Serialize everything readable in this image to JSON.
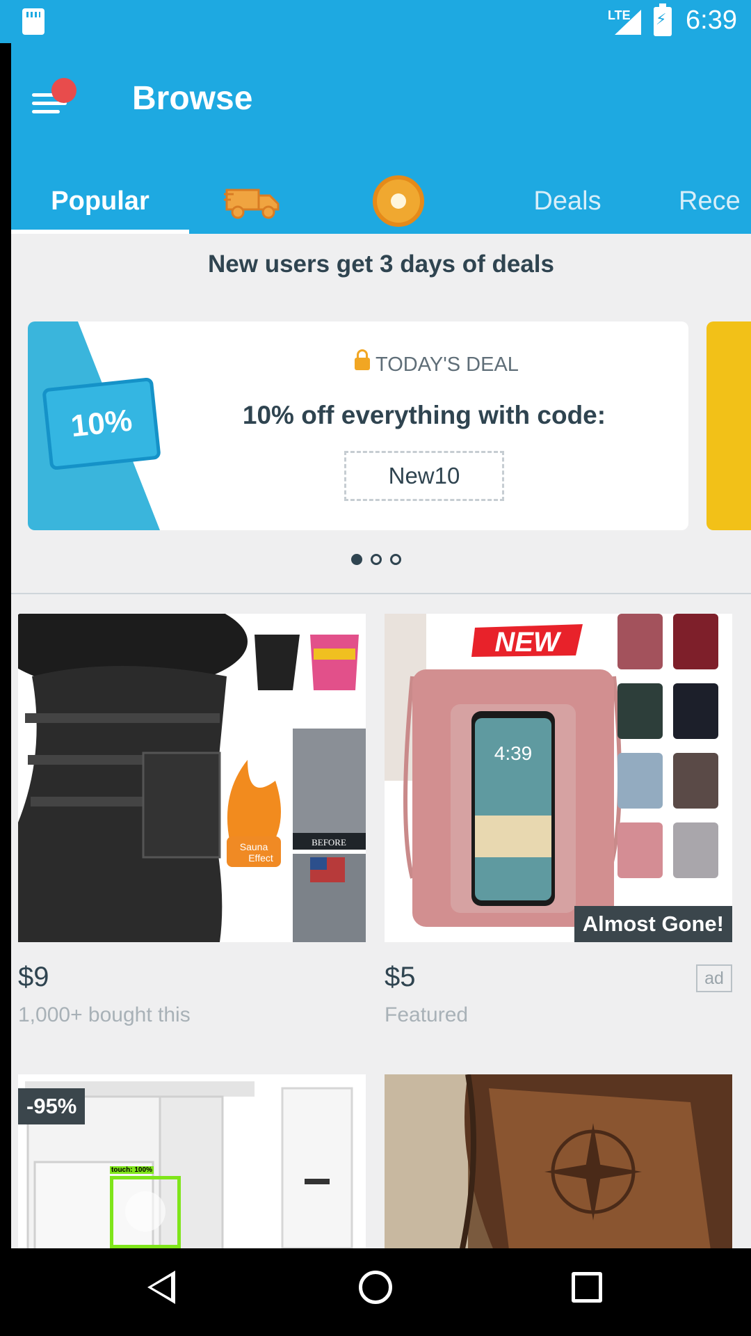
{
  "status_bar": {
    "network": "LTE",
    "time": "6:39"
  },
  "header": {
    "title": "Browse"
  },
  "tabs": [
    {
      "label": "Popular"
    },
    {
      "label": "",
      "icon": "delivery-truck-icon"
    },
    {
      "label": "",
      "icon": "coin-icon"
    },
    {
      "label": "Deals"
    },
    {
      "label": "Rece"
    }
  ],
  "promo": {
    "title": "New users get 3 days of deals",
    "card": {
      "ticket_text": "10%",
      "label": "TODAY'S DEAL",
      "headline": "10% off everything with code:",
      "code": "New10"
    },
    "pager_count": 3,
    "pager_active": 0
  },
  "products": [
    {
      "price": "$9",
      "subtitle": "1,000+ bought this",
      "image_badge_before": "BEFORE",
      "image_badge_sauna": "Sauna Effect"
    },
    {
      "price": "$5",
      "subtitle": "Featured",
      "badge": "Almost Gone!",
      "ad_label": "ad",
      "image_text_new": "NEW",
      "image_phone_time": "4:39"
    },
    {
      "discount": "-95%"
    },
    {}
  ],
  "touch_indicator": {
    "label": "touch: 100%"
  },
  "colors": {
    "primary": "#1ea9e1",
    "text_dark": "#2f4450",
    "badge_dark": "#3b464c",
    "notification_red": "#e84c4c"
  }
}
